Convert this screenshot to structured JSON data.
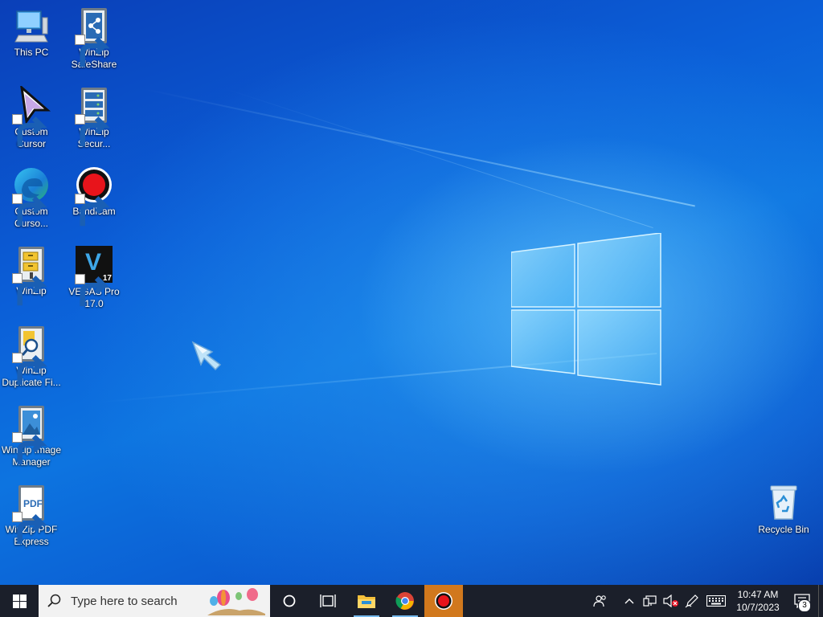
{
  "desktop": {
    "icons": [
      {
        "label": "This PC",
        "icon": "computer-icon"
      },
      {
        "label": "WinZip SafeShare",
        "icon": "winzip-safeshare-icon"
      },
      {
        "label": "Custom Cursor",
        "icon": "custom-cursor-icon"
      },
      {
        "label": "WinZip Secur...",
        "icon": "winzip-secure-icon"
      },
      {
        "label": "Custom Curso...",
        "icon": "edge-icon"
      },
      {
        "label": "Bandicam",
        "icon": "bandicam-icon"
      },
      {
        "label": "WinZip",
        "icon": "winzip-icon"
      },
      {
        "label": "VEGAS Pro 17.0",
        "icon": "vegas-pro-icon"
      },
      {
        "label": "WinZip Duplicate Fi...",
        "icon": "winzip-duplicate-icon"
      },
      {
        "label": "WinZip Image Manager",
        "icon": "winzip-image-icon"
      },
      {
        "label": "WinZip PDF Express",
        "icon": "winzip-pdf-icon"
      },
      {
        "label": "Recycle Bin",
        "icon": "recycle-bin-icon"
      }
    ],
    "vegas_version_badge": "17",
    "vegas_letter": "V",
    "pdf_text": "PDF"
  },
  "taskbar": {
    "search_placeholder": "Type here to search",
    "pinned": [
      "file-explorer-icon",
      "chrome-icon",
      "bandicam-icon"
    ],
    "clock": {
      "time": "10:47 AM",
      "date": "10/7/2023"
    },
    "notification_count": "3"
  },
  "colors": {
    "taskbar_bg": "#1b1f2a",
    "active_app": "#d1781d",
    "search_bg": "#f2f2f2",
    "running_indicator": "#76b9ed"
  }
}
